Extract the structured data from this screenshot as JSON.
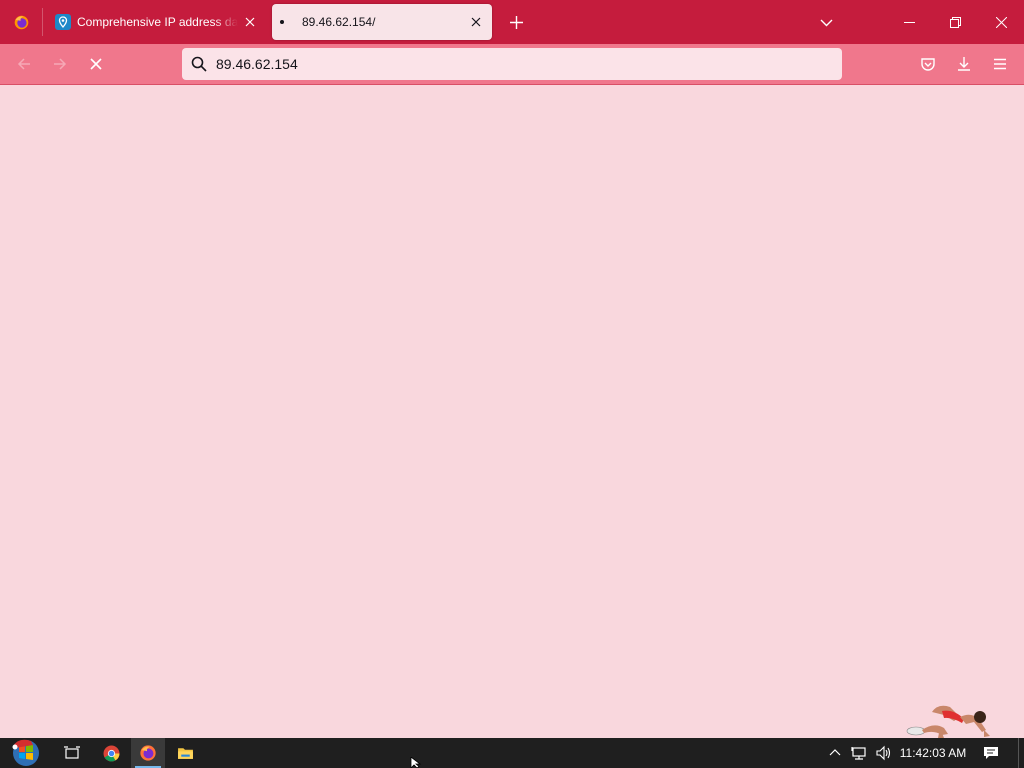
{
  "browser": {
    "tabs": [
      {
        "title": "Comprehensive IP address data,",
        "favicon": "location-pin-icon",
        "active": false
      },
      {
        "title": "89.46.62.154/",
        "favicon": "loading-dot",
        "active": true
      }
    ],
    "url_text": "89.46.62.154",
    "theme": {
      "tabstrip": "#c51c3d",
      "navbar": "#f0778c",
      "content": "#f9d7dd"
    }
  },
  "taskbar": {
    "apps": [
      "start-button",
      "task-view",
      "chrome",
      "firefox",
      "file-explorer"
    ],
    "clock": "11:42:03 AM"
  }
}
